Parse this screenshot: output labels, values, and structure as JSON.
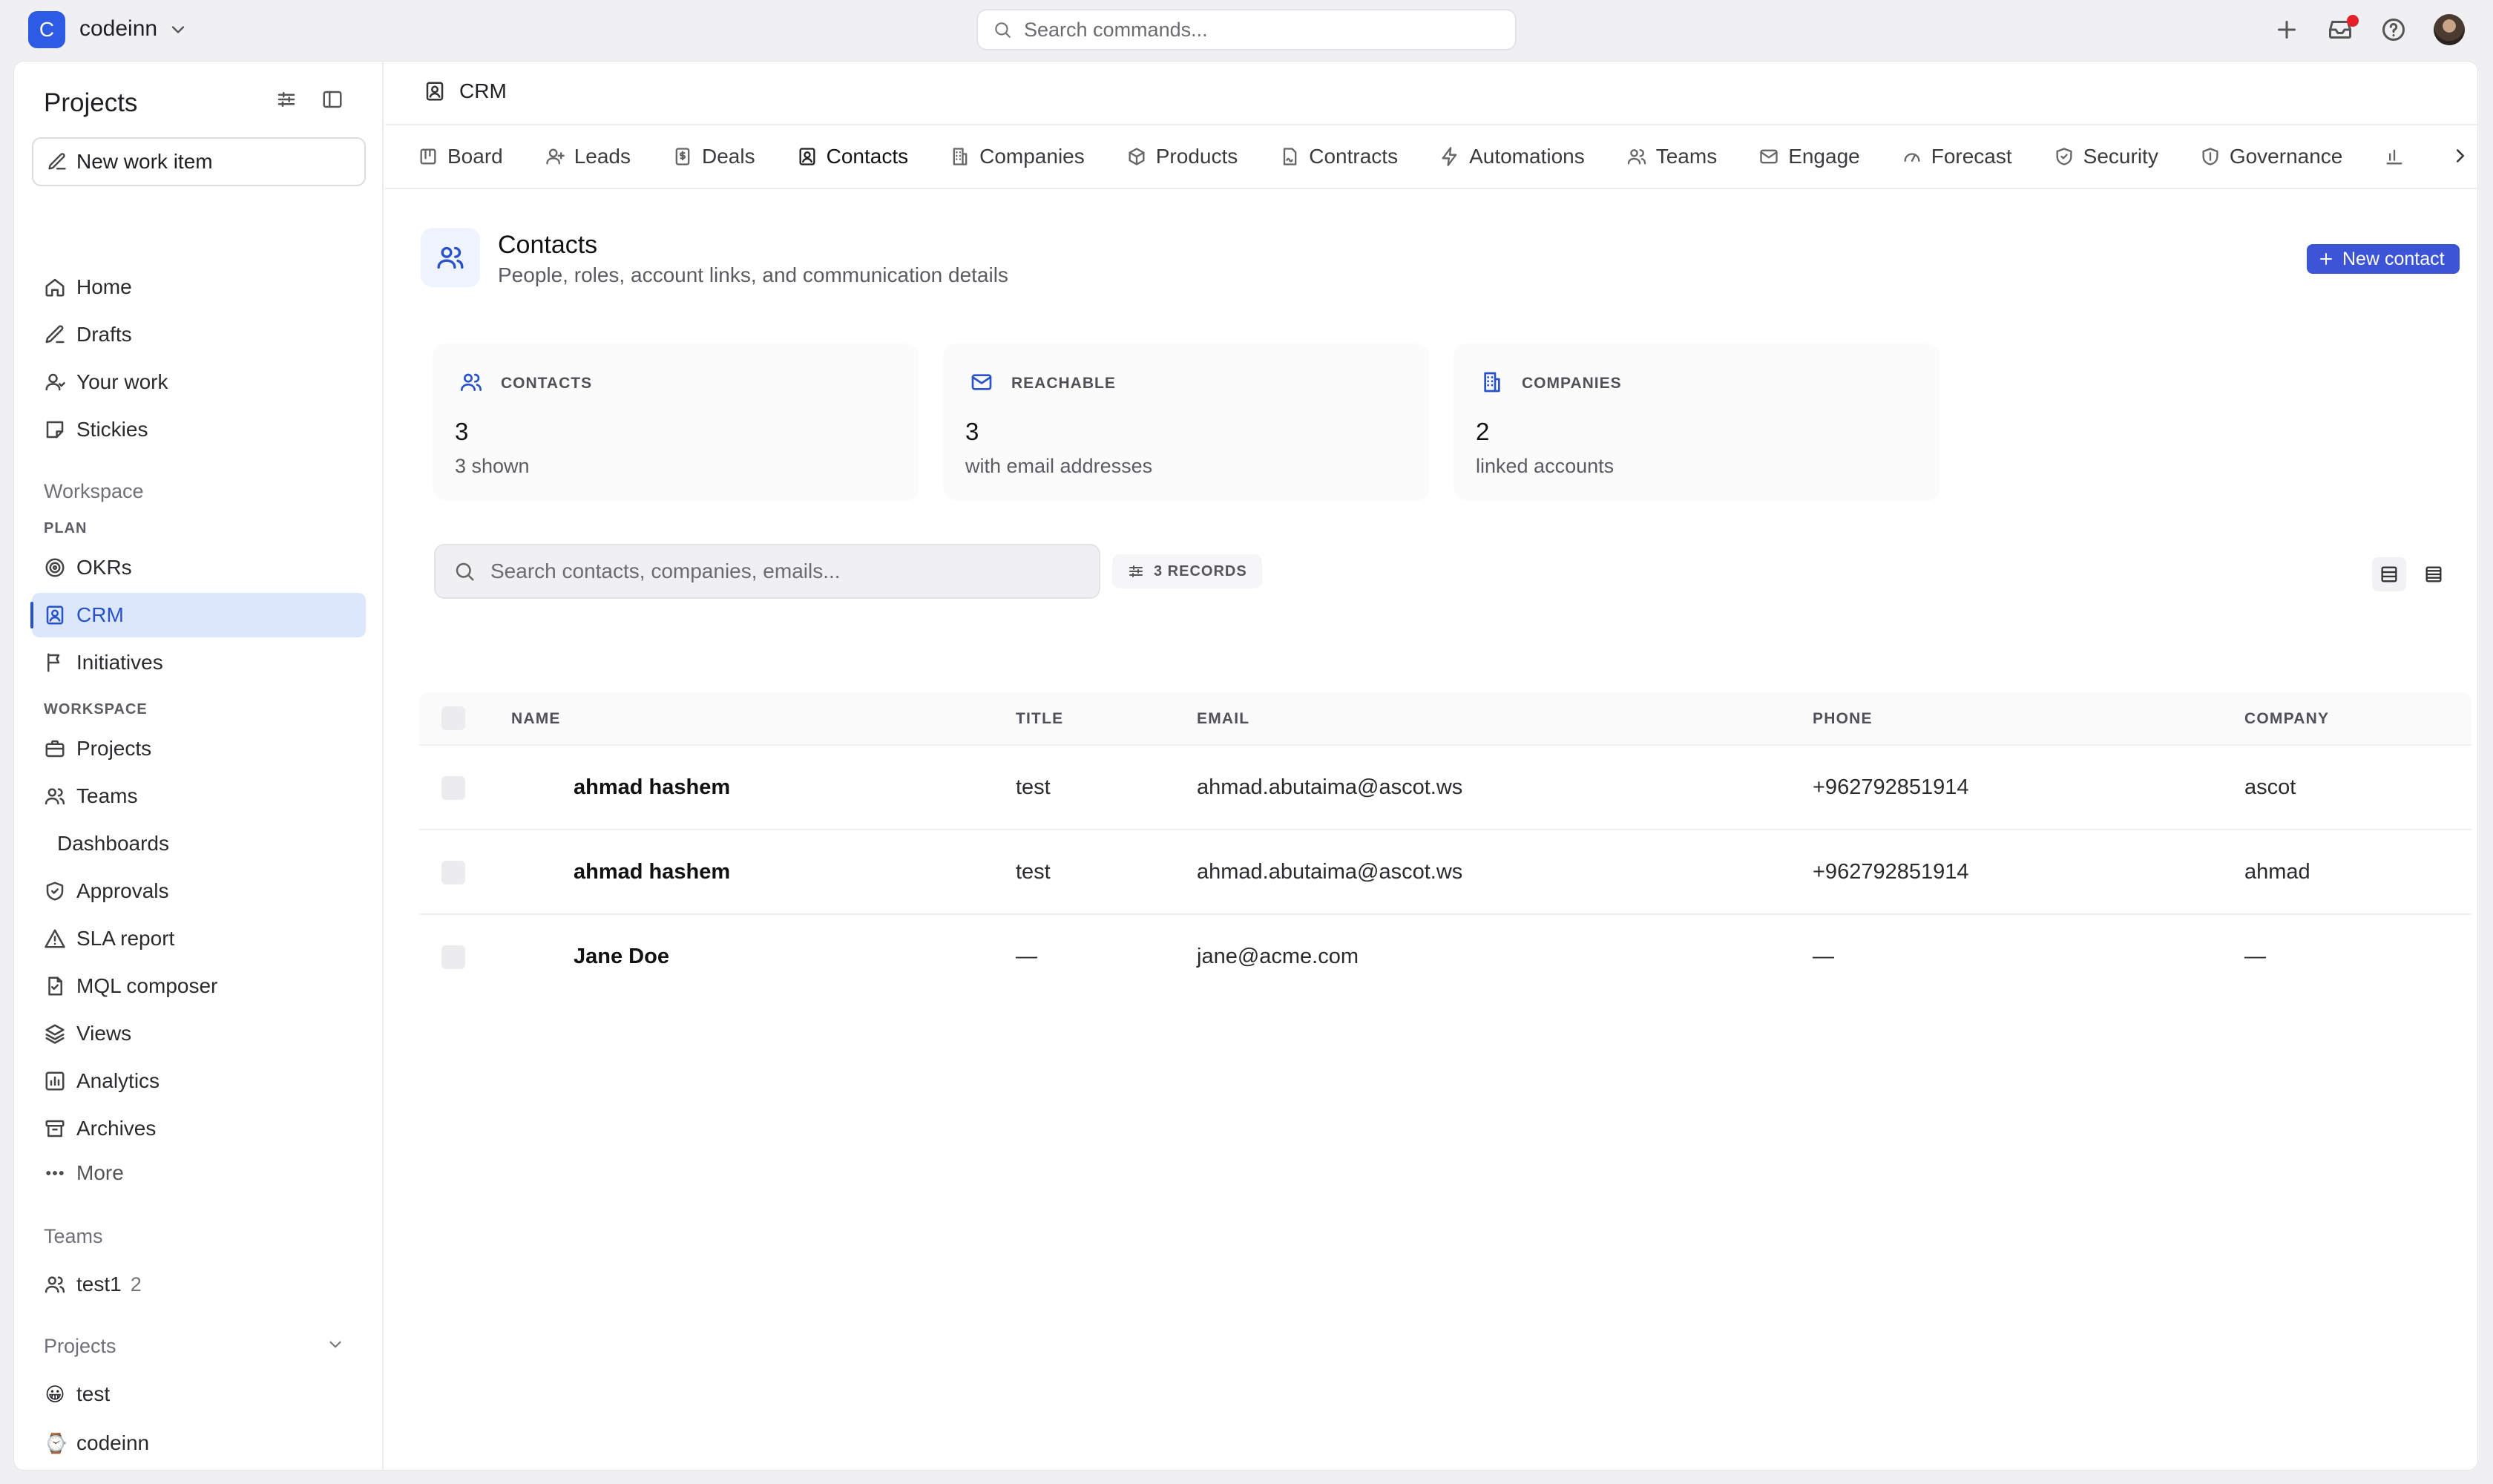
{
  "topbar": {
    "workspace_initial": "C",
    "workspace_name": "codeinn",
    "search_placeholder": "Search commands..."
  },
  "sidebar": {
    "title": "Projects",
    "new_work_item": "New work item",
    "primary": [
      {
        "label": "Home",
        "icon": "home-icon"
      },
      {
        "label": "Drafts",
        "icon": "pen-icon"
      },
      {
        "label": "Your work",
        "icon": "user-icon"
      },
      {
        "label": "Stickies",
        "icon": "sticky-note-icon"
      }
    ],
    "workspace_heading": "Workspace",
    "plan_caps": "PLAN",
    "plan_items": [
      {
        "label": "OKRs",
        "icon": "target-icon"
      },
      {
        "label": "CRM",
        "icon": "contact-card-icon",
        "active": true
      },
      {
        "label": "Initiatives",
        "icon": "flag-icon"
      }
    ],
    "workspace_caps": "WORKSPACE",
    "workspace_items": [
      {
        "label": "Projects",
        "icon": "briefcase-icon"
      },
      {
        "label": "Teams",
        "icon": "users-icon"
      },
      {
        "label": "Dashboards",
        "icon": ""
      },
      {
        "label": "Approvals",
        "icon": "shield-check-icon"
      },
      {
        "label": "SLA report",
        "icon": "warning-icon"
      },
      {
        "label": "MQL composer",
        "icon": "file-icon"
      },
      {
        "label": "Views",
        "icon": "layers-icon"
      },
      {
        "label": "Analytics",
        "icon": "bar-chart-icon"
      },
      {
        "label": "Archives",
        "icon": "archive-icon"
      },
      {
        "label": "More",
        "icon": "ellipsis-icon"
      }
    ],
    "teams_heading": "Teams",
    "teams": [
      {
        "label": "test1",
        "count": "2",
        "icon": "users-icon"
      }
    ],
    "projects_heading": "Projects",
    "projects": [
      {
        "label": "test",
        "emoji": "😀"
      },
      {
        "label": "codeinn",
        "emoji": "⌚"
      }
    ]
  },
  "main": {
    "breadcrumb": "CRM",
    "tabs": [
      {
        "label": "Board",
        "icon": "board-icon"
      },
      {
        "label": "Leads",
        "icon": "user-plus-icon"
      },
      {
        "label": "Deals",
        "icon": "dollar-doc-icon"
      },
      {
        "label": "Contacts",
        "icon": "contact-card-icon",
        "active": true
      },
      {
        "label": "Companies",
        "icon": "building-icon"
      },
      {
        "label": "Products",
        "icon": "box-icon"
      },
      {
        "label": "Contracts",
        "icon": "signature-icon"
      },
      {
        "label": "Automations",
        "icon": "bolt-icon"
      },
      {
        "label": "Teams",
        "icon": "users-icon"
      },
      {
        "label": "Engage",
        "icon": "mail-icon"
      },
      {
        "label": "Forecast",
        "icon": "gauge-icon"
      },
      {
        "label": "Security",
        "icon": "shield-check-icon"
      },
      {
        "label": "Governance",
        "icon": "shield-icon"
      }
    ],
    "page_title": "Contacts",
    "page_subtitle": "People, roles, account links, and communication details",
    "new_contact_label": "New contact",
    "stats": [
      {
        "label": "CONTACTS",
        "value": "3",
        "note": "3 shown",
        "icon": "users-icon"
      },
      {
        "label": "REACHABLE",
        "value": "3",
        "note": "with email addresses",
        "icon": "mail-icon"
      },
      {
        "label": "COMPANIES",
        "value": "2",
        "note": "linked accounts",
        "icon": "building-icon"
      }
    ],
    "search_placeholder": "Search contacts, companies, emails...",
    "records_label": "3 RECORDS",
    "table": {
      "columns": [
        "NAME",
        "TITLE",
        "EMAIL",
        "PHONE",
        "COMPANY"
      ],
      "rows": [
        {
          "name": "ahmad hashem",
          "title": "test",
          "email": "ahmad.abutaima@ascot.ws",
          "phone": "+962792851914",
          "company": "ascot"
        },
        {
          "name": "ahmad hashem",
          "title": "test",
          "email": "ahmad.abutaima@ascot.ws",
          "phone": "+962792851914",
          "company": "ahmad"
        },
        {
          "name": "Jane Doe",
          "title": "—",
          "email": "jane@acme.com",
          "phone": "—",
          "company": "—"
        }
      ]
    }
  },
  "colors": {
    "accent": "#2d5be3",
    "active_nav_bg": "#dde7fb",
    "primary_button": "#3c55d6",
    "notification_dot": "#e5202a"
  }
}
